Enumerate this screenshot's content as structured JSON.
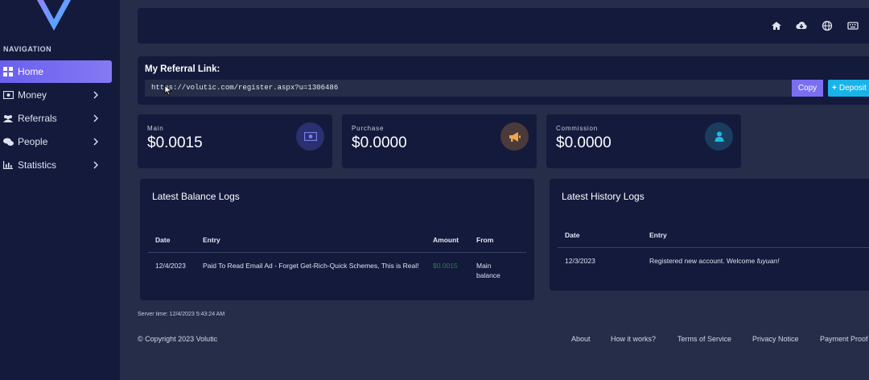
{
  "sidebar": {
    "heading": "NAVIGATION",
    "items": [
      {
        "label": "Home",
        "icon": "grid-icon",
        "active": true
      },
      {
        "label": "Money",
        "icon": "money-icon"
      },
      {
        "label": "Referrals",
        "icon": "users-icon"
      },
      {
        "label": "People",
        "icon": "chat-icon"
      },
      {
        "label": "Statistics",
        "icon": "bar-chart-icon"
      }
    ]
  },
  "topbar": {
    "icons": [
      "home-icon",
      "cloud-download-icon",
      "globe-icon",
      "keyboard-icon"
    ]
  },
  "referral": {
    "title": "My Referral Link:",
    "link": "https://volutic.com/register.aspx?u=1306486",
    "copy_label": "Copy",
    "deposit_label": "Deposit"
  },
  "stats": [
    {
      "label": "Main",
      "value": "$0.0015",
      "icon": "money-icon",
      "icon_color": "#6a6fd6",
      "bg_color": "#2a3170"
    },
    {
      "label": "Purchase",
      "value": "$0.0000",
      "icon": "megaphone-icon",
      "icon_color": "#f0a64a",
      "bg_color": "#4a3a3a"
    },
    {
      "label": "Commission",
      "value": "$0.0000",
      "icon": "user-icon",
      "icon_color": "#22b8e6",
      "bg_color": "#1a3d5e"
    }
  ],
  "balance_logs": {
    "title": "Latest Balance Logs",
    "headers": {
      "date": "Date",
      "entry": "Entry",
      "amount": "Amount",
      "from": "From"
    },
    "rows": [
      {
        "date": "12/4/2023",
        "entry": "Paid To Read Email Ad - Forget Get-Rich-Quick Schemes, This is Real!",
        "amount": "$0.0015",
        "from": "Main balance"
      }
    ]
  },
  "history_logs": {
    "title": "Latest History Logs",
    "headers": {
      "date": "Date",
      "entry": "Entry"
    },
    "rows": [
      {
        "date": "12/3/2023",
        "entry_text": "Registered new account. Welcome ",
        "entry_user": "fuyuan!"
      }
    ]
  },
  "server_time": "Server time: 12/4/2023 5:43:24 AM",
  "footer": {
    "copyright": "© Copyright 2023 Volutic",
    "links": [
      "About",
      "How it works?",
      "Terms of Service",
      "Privacy Notice",
      "Payment Proof"
    ]
  },
  "colors": {
    "accent": "#7a6ff3",
    "deposit": "#18b3e8",
    "amount_positive": "#1f8a3a",
    "panel": "#141a3c",
    "background": "#252d48"
  }
}
